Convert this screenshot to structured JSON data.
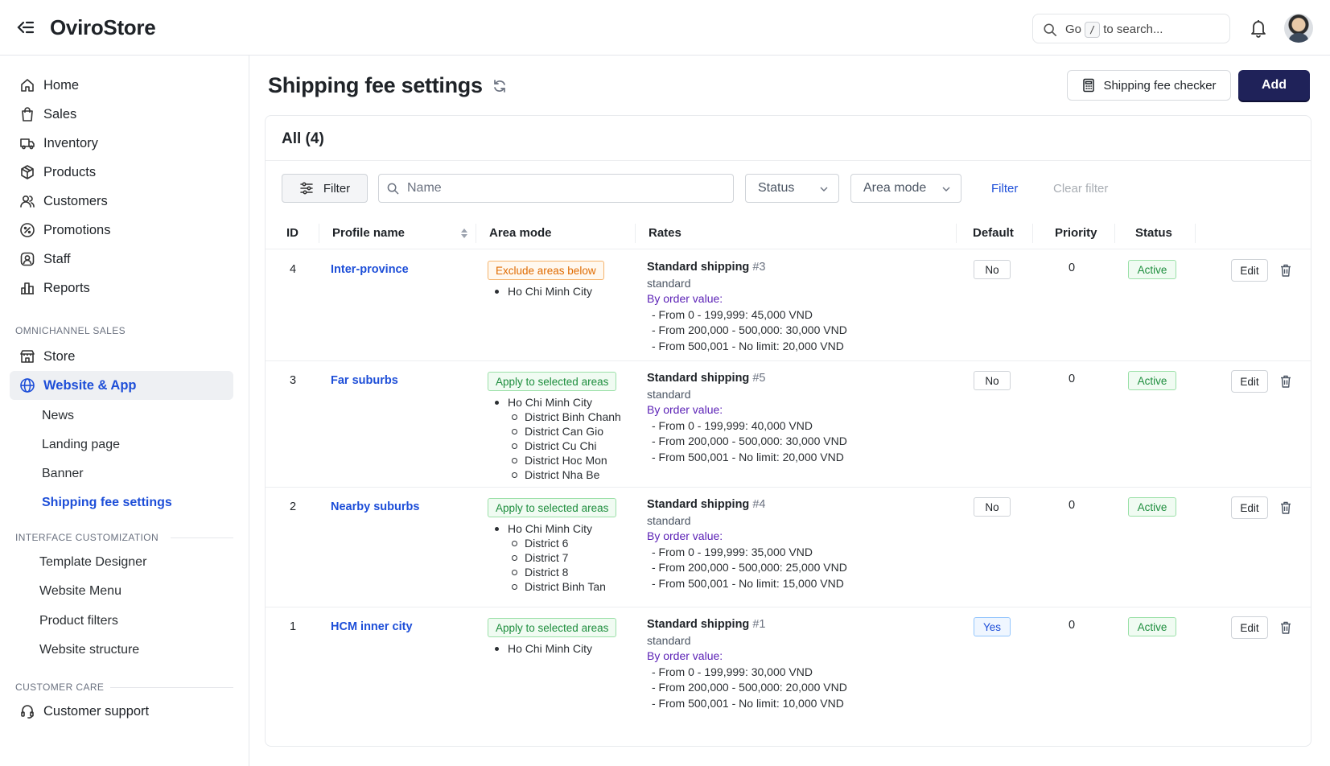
{
  "header": {
    "brand": "OviroStore",
    "search_before": "Go",
    "search_key": "/",
    "search_after": "to search..."
  },
  "sidebar": {
    "items": [
      {
        "label": "Home",
        "icon": "home-icon"
      },
      {
        "label": "Sales",
        "icon": "shopping-bag-icon"
      },
      {
        "label": "Inventory",
        "icon": "truck-icon"
      },
      {
        "label": "Products",
        "icon": "box-icon"
      },
      {
        "label": "Customers",
        "icon": "users-icon"
      },
      {
        "label": "Promotions",
        "icon": "percent-icon"
      },
      {
        "label": "Staff",
        "icon": "user-circle-icon"
      },
      {
        "label": "Reports",
        "icon": "bar-chart-icon"
      }
    ],
    "section_omnichannel": "OMNICHANNEL SALES",
    "store": "Store",
    "website_app": "Website & App",
    "website_sub": [
      "News",
      "Landing page",
      "Banner",
      "Shipping fee settings"
    ],
    "section_interface": "INTERFACE CUSTOMIZATION",
    "interface_items": [
      "Template Designer",
      "Website Menu",
      "Product filters",
      "Website structure"
    ],
    "section_care": "CUSTOMER CARE",
    "support": "Customer support"
  },
  "page": {
    "title": "Shipping fee settings",
    "checker_label": "Shipping fee checker",
    "add_label": "Add"
  },
  "card": {
    "title": "All (4)",
    "filter_button": "Filter",
    "name_placeholder": "Name",
    "status_select": "Status",
    "area_select": "Area mode",
    "filter_link": "Filter",
    "clear_link": "Clear filter"
  },
  "table": {
    "headers": {
      "id": "ID",
      "name": "Profile name",
      "area": "Area mode",
      "rates": "Rates",
      "default": "Default",
      "priority": "Priority",
      "status": "Status"
    },
    "rows": [
      {
        "id": "4",
        "name": "Inter-province",
        "mode": "Exclude areas below",
        "areas": [
          "Ho Chi Minh City"
        ],
        "sub_areas": [],
        "rate_title": "Standard shipping",
        "rate_num": "#3",
        "rate_code": "standard",
        "by": "By order value:",
        "lines": [
          "- From 0 - 199,999: 45,000 VND",
          "- From 200,000 - 500,000: 30,000 VND",
          "- From 500,001 - No limit: 20,000 VND"
        ],
        "default": "No",
        "priority": "0",
        "status": "Active",
        "edit": "Edit"
      },
      {
        "id": "3",
        "name": "Far suburbs",
        "mode": "Apply to selected areas",
        "areas": [
          "Ho Chi Minh City"
        ],
        "sub_areas": [
          "District Binh Chanh",
          "District Can Gio",
          "District Cu Chi",
          "District Hoc Mon",
          "District Nha Be"
        ],
        "rate_title": "Standard shipping",
        "rate_num": "#5",
        "rate_code": "standard",
        "by": "By order value:",
        "lines": [
          "- From 0 - 199,999: 40,000 VND",
          "- From 200,000 - 500,000: 30,000 VND",
          "- From 500,001 - No limit: 20,000 VND"
        ],
        "default": "No",
        "priority": "0",
        "status": "Active",
        "edit": "Edit"
      },
      {
        "id": "2",
        "name": "Nearby suburbs",
        "mode": "Apply to selected areas",
        "areas": [
          "Ho Chi Minh City"
        ],
        "sub_areas": [
          "District 6",
          "District 7",
          "District 8",
          "District Binh Tan"
        ],
        "rate_title": "Standard shipping",
        "rate_num": "#4",
        "rate_code": "standard",
        "by": "By order value:",
        "lines": [
          "- From 0 - 199,999: 35,000 VND",
          "- From 200,000 - 500,000: 25,000 VND",
          "- From 500,001 - No limit: 15,000 VND"
        ],
        "default": "No",
        "priority": "0",
        "status": "Active",
        "edit": "Edit"
      },
      {
        "id": "1",
        "name": "HCM inner city",
        "mode": "Apply to selected areas",
        "areas": [
          "Ho Chi Minh City"
        ],
        "sub_areas": [],
        "rate_title": "Standard shipping",
        "rate_num": "#1",
        "rate_code": "standard",
        "by": "By order value:",
        "lines": [
          "- From 0 - 199,999: 30,000 VND",
          "- From 200,000 - 500,000: 20,000 VND",
          "- From 500,001 - No limit: 10,000 VND"
        ],
        "default": "Yes",
        "priority": "0",
        "status": "Active",
        "edit": "Edit"
      }
    ]
  },
  "colors": {
    "accent": "#1d4ed8",
    "primary_button": "#1f2259",
    "active_green": "#1e8e3e",
    "exclude_orange": "#e06b00",
    "rate_purple": "#5b21b6"
  }
}
